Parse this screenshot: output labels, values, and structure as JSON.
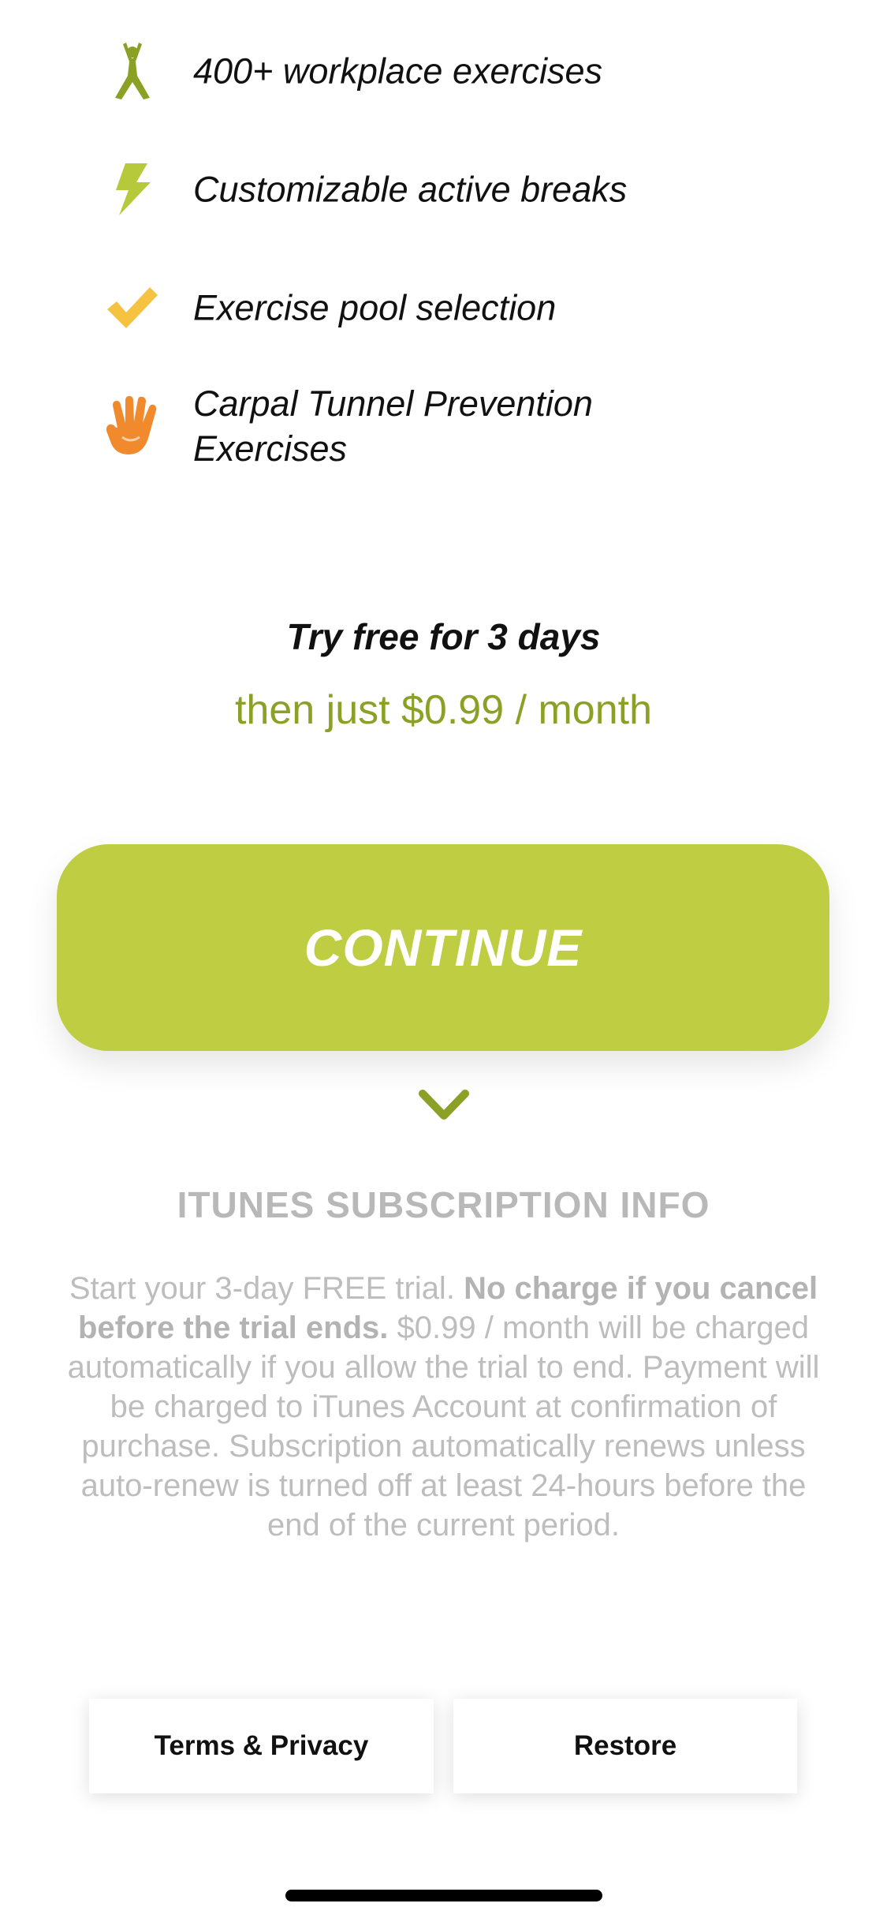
{
  "features": [
    {
      "icon": "person-exercise-icon",
      "label": "400+ workplace exercises",
      "color": "#8aa126"
    },
    {
      "icon": "lightning-bolt-icon",
      "label": "Customizable active breaks",
      "color": "#b5c93a"
    },
    {
      "icon": "checkmark-icon",
      "label": "Exercise pool selection",
      "color": "#f5c242"
    },
    {
      "icon": "raised-hand-icon",
      "label": "Carpal Tunnel Prevention Exercises",
      "color": "#f08a2c"
    }
  ],
  "trial": {
    "title": "Try free for 3 days",
    "price": "then just $0.99 / month"
  },
  "continue_button": {
    "label": "CONTINUE",
    "color": "#bfcd42"
  },
  "info": {
    "title": "ITUNES SUBSCRIPTION INFO",
    "text_start": "Start your 3-day FREE trial.",
    "text_bold": "No charge if you cancel before the trial ends.",
    "text_rest": "$0.99 / month will be charged automatically if you allow the trial to end. Payment will be charged to iTunes Account at confirmation of purchase. Subscription automatically renews unless auto-renew is turned off at least 24-hours before the end of the current period."
  },
  "bottom_buttons": {
    "terms": "Terms & Privacy",
    "restore": "Restore"
  },
  "colors": {
    "accent": "#8aa126",
    "button": "#bfcd42",
    "muted_text": "#bdbdbd"
  }
}
